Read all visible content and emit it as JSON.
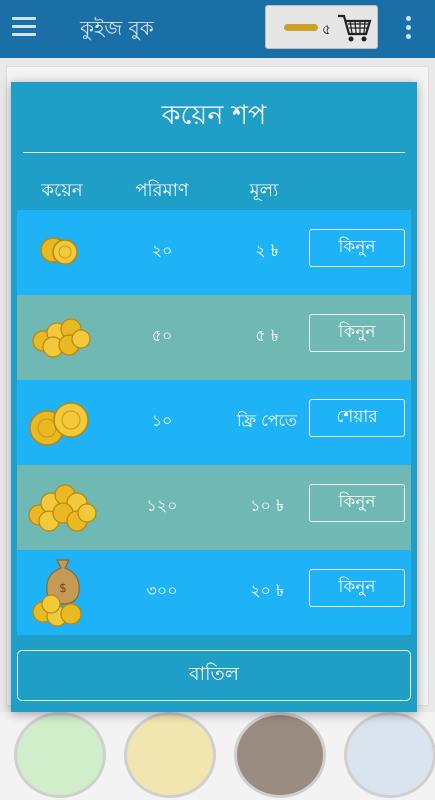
{
  "appbar": {
    "title": "কুইজ বুক",
    "coin_count": "৫"
  },
  "dialog": {
    "title": "কয়েন শপ",
    "headers": {
      "coin": "কয়েন",
      "amount": "পরিমাণ",
      "price": "মূল্য"
    },
    "rows": [
      {
        "qty": "২০",
        "price": "২ ৳",
        "button": "কিনুন",
        "coin_icon": "coins-small-icon"
      },
      {
        "qty": "৫০",
        "price": "৫ ৳",
        "button": "কিনুন",
        "coin_icon": "coins-medium-icon"
      },
      {
        "qty": "১০",
        "price": "ফ্রি পেতে",
        "button": "শেয়ার",
        "coin_icon": "coins-pair-icon"
      },
      {
        "qty": "১২০",
        "price": "১০ ৳",
        "button": "কিনুন",
        "coin_icon": "coins-pile-icon"
      },
      {
        "qty": "৩০০",
        "price": "২০ ৳",
        "button": "কিনুন",
        "coin_icon": "coin-bag-icon"
      }
    ],
    "cancel": "বাতিল"
  },
  "colors": {
    "appbar": "#1b6fa7",
    "dialog": "#1f9fc7",
    "row_blue": "#1eb3f6",
    "row_teal": "#6fb8b4",
    "coin_gold": "#e8b923"
  }
}
